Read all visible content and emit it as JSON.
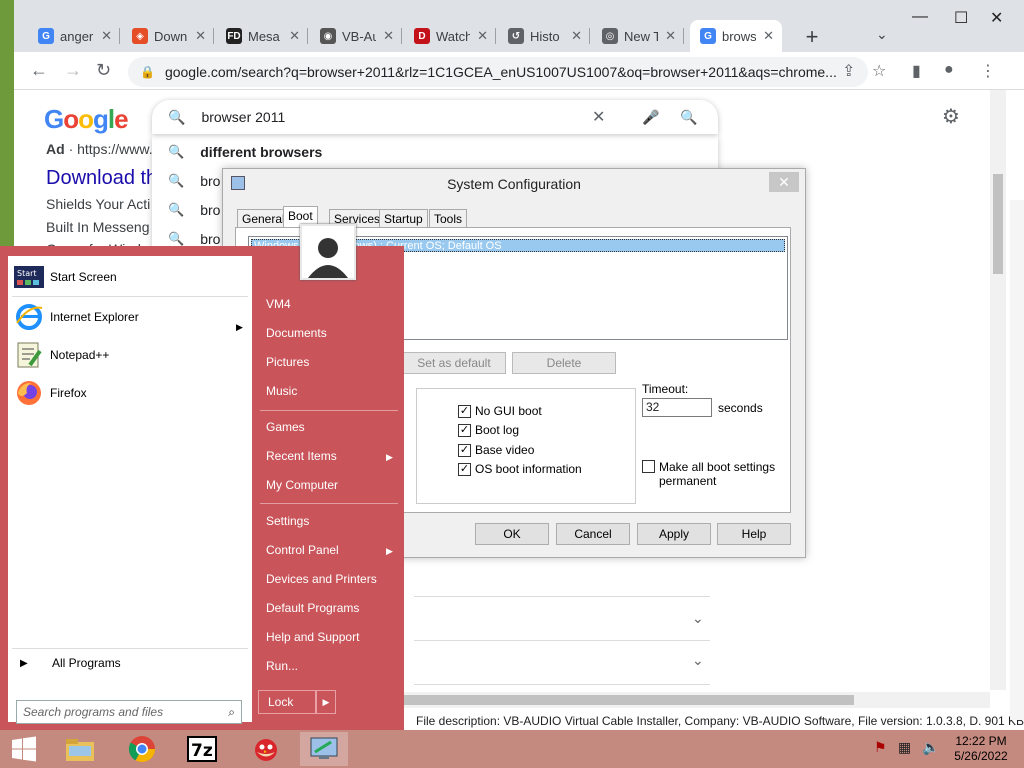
{
  "browser": {
    "tabs": [
      {
        "label": "anger",
        "favicon": "google-icon",
        "color": "#4285f4",
        "glyph": "G"
      },
      {
        "label": "Down",
        "favicon": "shield-favicon",
        "color": "#e44d26",
        "glyph": "◈"
      },
      {
        "label": "Mesa",
        "favicon": "fd-favicon",
        "color": "#222222",
        "glyph": "FD"
      },
      {
        "label": "VB-Au",
        "favicon": "globe-favicon",
        "color": "#555555",
        "glyph": "◉"
      },
      {
        "label": "Watch",
        "favicon": "disney-favicon",
        "color": "#c4121a",
        "glyph": "D"
      },
      {
        "label": "Histo",
        "favicon": "history-icon",
        "color": "#5f6368",
        "glyph": "↺"
      },
      {
        "label": "New T",
        "favicon": "chrome-icon",
        "color": "#5f6368",
        "glyph": "◎"
      },
      {
        "label": "brows",
        "favicon": "google-icon",
        "color": "#4285f4",
        "glyph": "G"
      }
    ],
    "url": "google.com/search?q=browser+2011&rlz=1C1GCEA_enUS1007US1007&oq=browser+2011&aqs=chrome..."
  },
  "google": {
    "logo": "Google",
    "query": "browser 2011",
    "suggestions": [
      "different browsers",
      "bro",
      "bro",
      "bro"
    ],
    "ad_label": "Ad",
    "ad_url": "· https://www.",
    "ad_title": "Download th",
    "ad_lines": [
      "Shields Your Acti",
      "Built In Messeng",
      "Opera for Windo"
    ],
    "statusbar": "File description: VB-AUDIO Virtual Cable Installer, Company: VB-AUDIO Software, File version: 1.0.3.8, D. 901 KB"
  },
  "syscfg": {
    "title": "System Configuration",
    "tabs": [
      "General",
      "Boot",
      "Services",
      "Startup",
      "Tools"
    ],
    "os_entry": "Windows 7 (C:\\Windows) : Current OS; Default OS",
    "buttons_mid": [
      "Set as default",
      "Delete"
    ],
    "boot_options": [
      {
        "label": "No GUI boot",
        "checked": true
      },
      {
        "label": "Boot log",
        "checked": true
      },
      {
        "label": "Base video",
        "checked": true
      },
      {
        "label": "OS boot information",
        "checked": true
      }
    ],
    "timeout_label": "Timeout:",
    "timeout_value": "32",
    "timeout_unit": "seconds",
    "make_permanent": "Make all boot settings permanent",
    "footer_buttons": [
      "OK",
      "Cancel",
      "Apply",
      "Help"
    ]
  },
  "startmenu": {
    "left_items": [
      {
        "label": "Start Screen",
        "icon": "start-screen-icon"
      },
      {
        "label": "Internet Explorer",
        "icon": "ie-icon",
        "submenu": true
      },
      {
        "label": "Notepad++",
        "icon": "notepadpp-icon"
      },
      {
        "label": "Firefox",
        "icon": "firefox-icon"
      }
    ],
    "start_tile_text": "Start",
    "all_programs": "All Programs",
    "search_placeholder": "Search programs and files",
    "right_items": [
      {
        "label": "VM4"
      },
      {
        "label": "Documents"
      },
      {
        "label": "Pictures"
      },
      {
        "label": "Music"
      },
      {
        "label": "Games"
      },
      {
        "label": "Recent Items",
        "submenu": true
      },
      {
        "label": "My Computer"
      },
      {
        "label": "Settings"
      },
      {
        "label": "Control Panel",
        "submenu": true
      },
      {
        "label": "Devices and Printers"
      },
      {
        "label": "Default Programs"
      },
      {
        "label": "Help and Support"
      },
      {
        "label": "Run..."
      }
    ],
    "lock_label": "Lock"
  },
  "taskbar": {
    "time": "12:22 PM",
    "date": "5/26/2022",
    "apps": [
      "windows-logo",
      "file-explorer-icon",
      "chrome-icon",
      "7zip-icon",
      "angry-birds-icon",
      "msconfig-icon"
    ]
  }
}
